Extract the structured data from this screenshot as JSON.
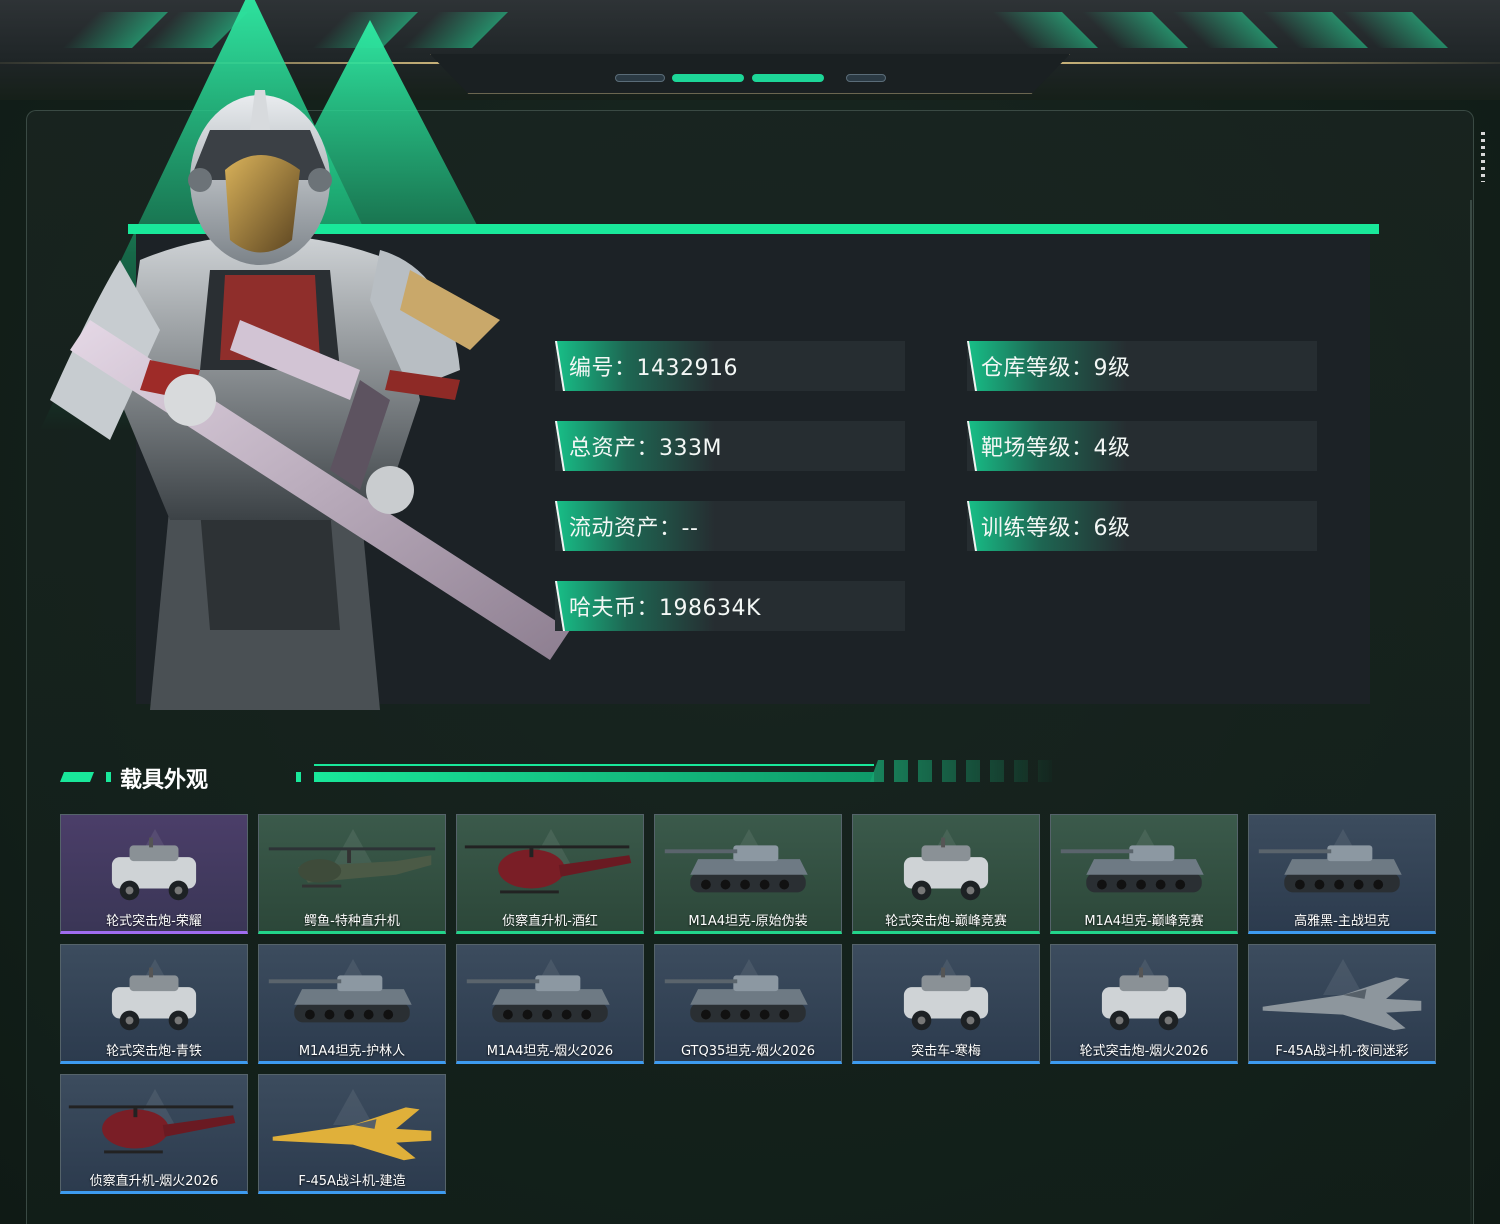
{
  "player": {
    "fields": [
      {
        "label": "编号：1432916"
      },
      {
        "label": "仓库等级：9级"
      },
      {
        "label": "总资产：333M"
      },
      {
        "label": "靶场等级：4级"
      },
      {
        "label": "流动资产：--"
      },
      {
        "label": "训练等级：6级"
      },
      {
        "label": "哈夫币：198634K"
      }
    ]
  },
  "vehicles_section": {
    "title": "载具外观",
    "items": [
      {
        "name": "轮式突击炮-荣耀",
        "rarity": "purple",
        "kind": "armored-car"
      },
      {
        "name": "鳄鱼-特种直升机",
        "rarity": "green",
        "kind": "attack-heli"
      },
      {
        "name": "侦察直升机-酒红",
        "rarity": "green",
        "kind": "scout-heli"
      },
      {
        "name": "M1A4坦克-原始伪装",
        "rarity": "green",
        "kind": "tank"
      },
      {
        "name": "轮式突击炮-巅峰竞赛",
        "rarity": "green",
        "kind": "armored-car"
      },
      {
        "name": "M1A4坦克-巅峰竞赛",
        "rarity": "green",
        "kind": "tank"
      },
      {
        "name": "高雅黑-主战坦克",
        "rarity": "blue",
        "kind": "tank"
      },
      {
        "name": "轮式突击炮-青铁",
        "rarity": "blue",
        "kind": "armored-car"
      },
      {
        "name": "M1A4坦克-护林人",
        "rarity": "blue",
        "kind": "tank"
      },
      {
        "name": "M1A4坦克-烟火2026",
        "rarity": "blue",
        "kind": "tank"
      },
      {
        "name": "GTQ35坦克-烟火2026",
        "rarity": "blue",
        "kind": "tank"
      },
      {
        "name": "突击车-寒梅",
        "rarity": "blue",
        "kind": "armored-car"
      },
      {
        "name": "轮式突击炮-烟火2026",
        "rarity": "blue",
        "kind": "armored-car"
      },
      {
        "name": "F-45A战斗机-夜间迷彩",
        "rarity": "blue",
        "kind": "jet"
      },
      {
        "name": "侦察直升机-烟火2026",
        "rarity": "blue",
        "kind": "scout-heli"
      },
      {
        "name": "F-45A战斗机-建造",
        "rarity": "blue",
        "kind": "jet"
      }
    ]
  },
  "colors": {
    "accent": "#19e89a",
    "rarity_purple": "#a06cf0",
    "rarity_green": "#22d48a",
    "rarity_blue": "#3d9bf0"
  }
}
